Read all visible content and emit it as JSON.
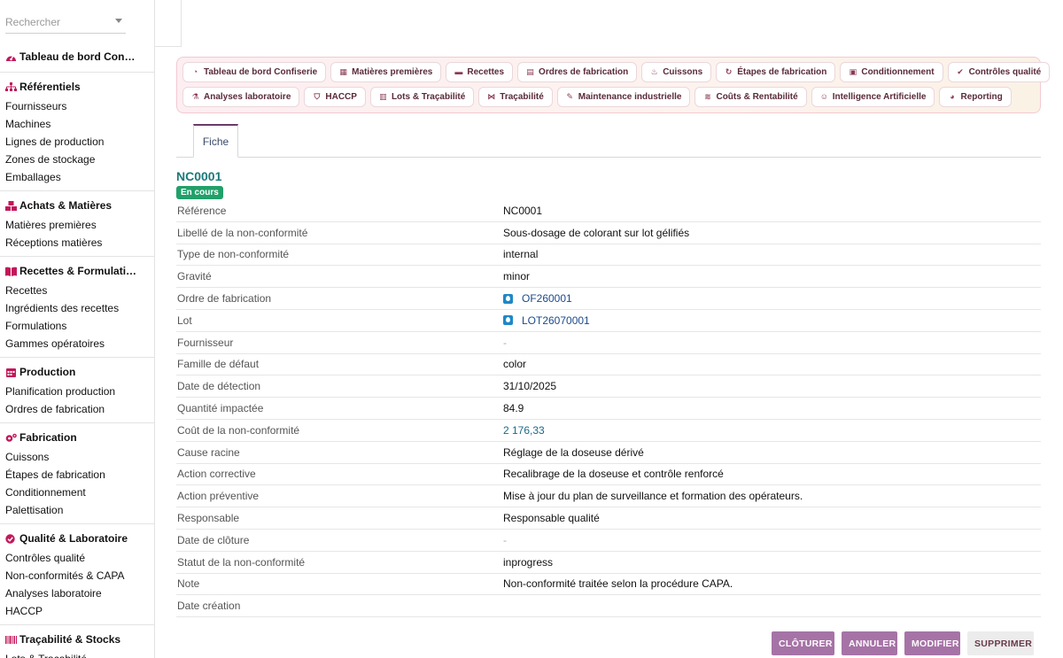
{
  "search": {
    "placeholder": "Rechercher"
  },
  "sidebar": {
    "groups": [
      {
        "title": "Tableau de bord Con…",
        "icon": "gauge-icon",
        "items": []
      },
      {
        "title": "Référentiels",
        "icon": "sitemap-icon",
        "items": [
          "Fournisseurs",
          "Machines",
          "Lignes de production",
          "Zones de stockage",
          "Emballages"
        ]
      },
      {
        "title": "Achats & Matières",
        "icon": "boxes-icon",
        "items": [
          "Matières premières",
          "Réceptions matières"
        ]
      },
      {
        "title": "Recettes & Formulati…",
        "icon": "book-icon",
        "items": [
          "Recettes",
          "Ingrédients des recettes",
          "Formulations",
          "Gammes opératoires"
        ]
      },
      {
        "title": "Production",
        "icon": "calendar-icon",
        "items": [
          "Planification production",
          "Ordres de fabrication"
        ]
      },
      {
        "title": "Fabrication",
        "icon": "gears-icon",
        "items": [
          "Cuissons",
          "Étapes de fabrication",
          "Conditionnement",
          "Palettisation"
        ]
      },
      {
        "title": "Qualité & Laboratoire",
        "icon": "check-circle-icon",
        "items": [
          "Contrôles qualité",
          "Non-conformités & CAPA",
          "Analyses laboratoire",
          "HACCP"
        ]
      },
      {
        "title": "Traçabilité & Stocks",
        "icon": "barcode-icon",
        "items": [
          "Lots & Traçabilité"
        ]
      }
    ],
    "accent": "#c2185b"
  },
  "modules": {
    "row1": [
      {
        "label": "Tableau de bord Confiserie",
        "icon": "gauge-icon",
        "glyph": "◔"
      },
      {
        "label": "Matières premières",
        "icon": "boxes-icon",
        "glyph": "▦"
      },
      {
        "label": "Recettes",
        "icon": "book-icon",
        "glyph": "▬"
      },
      {
        "label": "Ordres de fabrication",
        "icon": "clipboard-icon",
        "glyph": "▤"
      },
      {
        "label": "Cuissons",
        "icon": "flame-icon",
        "glyph": "♨"
      },
      {
        "label": "Étapes de fabrication",
        "icon": "refresh-icon",
        "glyph": "↻"
      },
      {
        "label": "Conditionnement",
        "icon": "box-icon",
        "glyph": "▣"
      },
      {
        "label": "Contrôles qualité",
        "icon": "check-circle-icon",
        "glyph": "✔"
      }
    ],
    "row2": [
      {
        "label": "Analyses laboratoire",
        "icon": "flask-icon",
        "glyph": "⚗"
      },
      {
        "label": "HACCP",
        "icon": "shield-icon",
        "glyph": "⛉"
      },
      {
        "label": "Lots & Traçabilité",
        "icon": "barcode-icon",
        "glyph": "▥"
      },
      {
        "label": "Traçabilité",
        "icon": "network-icon",
        "glyph": "⋈"
      },
      {
        "label": "Maintenance industrielle",
        "icon": "wrench-icon",
        "glyph": "✎"
      },
      {
        "label": "Coûts & Rentabilité",
        "icon": "coins-icon",
        "glyph": "≋"
      },
      {
        "label": "Intelligence Artificielle",
        "icon": "robot-icon",
        "glyph": "☺"
      },
      {
        "label": "Reporting",
        "icon": "pie-icon",
        "glyph": "◕"
      }
    ]
  },
  "tabs": [
    {
      "label": "Fiche",
      "active": true
    }
  ],
  "record": {
    "title": "NC0001",
    "status_badge": "En cours",
    "status_color": "#21a06a",
    "fields": [
      {
        "label": "Référence",
        "value": "NC0001",
        "kind": "text"
      },
      {
        "label": "Libellé de la non-conformité",
        "value": "Sous-dosage de colorant sur lot gélifiés",
        "kind": "text"
      },
      {
        "label": "Type de non-conformité",
        "value": "internal",
        "kind": "text"
      },
      {
        "label": "Gravité",
        "value": "minor",
        "kind": "text"
      },
      {
        "label": "Ordre de fabrication",
        "value": "OF260001",
        "kind": "link"
      },
      {
        "label": "Lot",
        "value": "LOT26070001",
        "kind": "link"
      },
      {
        "label": "Fournisseur",
        "value": "-",
        "kind": "muted"
      },
      {
        "label": "Famille de défaut",
        "value": "color",
        "kind": "text"
      },
      {
        "label": "Date de détection",
        "value": "31/10/2025",
        "kind": "text"
      },
      {
        "label": "Quantité impactée",
        "value": "84.9",
        "kind": "text"
      },
      {
        "label": "Coût de la non-conformité",
        "value": "2 176,33",
        "kind": "cost"
      },
      {
        "label": "Cause racine",
        "value": "Réglage de la doseuse dérivé",
        "kind": "text"
      },
      {
        "label": "Action corrective",
        "value": "Recalibrage de la doseuse et contrôle renforcé",
        "kind": "text"
      },
      {
        "label": "Action préventive",
        "value": "Mise à jour du plan de surveillance et formation des opérateurs.",
        "kind": "text"
      },
      {
        "label": "Responsable",
        "value": "Responsable qualité",
        "kind": "text"
      },
      {
        "label": "Date de clôture",
        "value": "-",
        "kind": "muted"
      },
      {
        "label": "Statut de la non-conformité",
        "value": "inprogress",
        "kind": "text"
      },
      {
        "label": "Note",
        "value": "Non-conformité traitée selon la procédure CAPA.",
        "kind": "text"
      },
      {
        "label": "Date création",
        "value": "",
        "kind": "text"
      }
    ]
  },
  "actions": {
    "close_label": "CLÔTURER",
    "cancel_label": "ANNULER",
    "edit_label": "MODIFIER",
    "delete_label": "SUPPRIMER",
    "primary_color": "#a673a6"
  }
}
